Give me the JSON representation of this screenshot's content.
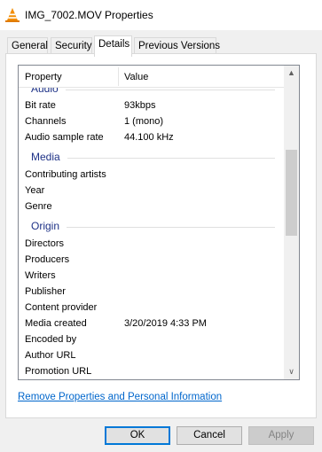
{
  "window": {
    "title": "IMG_7002.MOV Properties",
    "icon": "vlc-cone-icon"
  },
  "tabs": [
    {
      "label": "General",
      "active": false
    },
    {
      "label": "Security",
      "active": false
    },
    {
      "label": "Details",
      "active": true
    },
    {
      "label": "Previous Versions",
      "active": false
    }
  ],
  "list": {
    "headers": {
      "property": "Property",
      "value": "Value"
    },
    "partial_group": "Audio",
    "audio_rows": [
      {
        "property": "Bit rate",
        "value": "93kbps"
      },
      {
        "property": "Channels",
        "value": "1 (mono)"
      },
      {
        "property": "Audio sample rate",
        "value": "44.100 kHz"
      }
    ],
    "media_group": "Media",
    "media_rows": [
      {
        "property": "Contributing artists",
        "value": ""
      },
      {
        "property": "Year",
        "value": ""
      },
      {
        "property": "Genre",
        "value": ""
      }
    ],
    "origin_group": "Origin",
    "origin_rows": [
      {
        "property": "Directors",
        "value": ""
      },
      {
        "property": "Producers",
        "value": ""
      },
      {
        "property": "Writers",
        "value": ""
      },
      {
        "property": "Publisher",
        "value": ""
      },
      {
        "property": "Content provider",
        "value": ""
      },
      {
        "property": "Media created",
        "value": "3/20/2019 4:33 PM"
      },
      {
        "property": "Encoded by",
        "value": ""
      },
      {
        "property": "Author URL",
        "value": ""
      },
      {
        "property": "Promotion URL",
        "value": ""
      }
    ],
    "scroll_up_glyph": "▲",
    "scroll_down_glyph": "∨"
  },
  "remove_link": "Remove Properties and Personal Information",
  "buttons": {
    "ok": "OK",
    "cancel": "Cancel",
    "apply": "Apply"
  },
  "colors": {
    "group_header": "#1e3287",
    "link": "#0066cc",
    "default_button_border": "#0078d7"
  }
}
